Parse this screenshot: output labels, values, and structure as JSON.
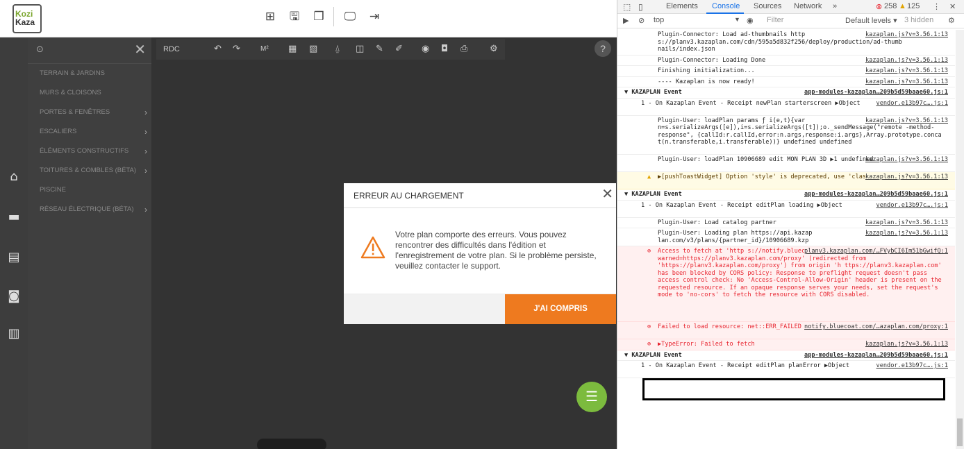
{
  "app": {
    "logo": {
      "line1": "Kozi",
      "line2": "Kaza"
    },
    "level": "RDC",
    "toolbar2": {
      "m2": "M²"
    },
    "sidebar": {
      "items": [
        {
          "label": "TERRAIN & JARDINS",
          "has_chevron": false
        },
        {
          "label": "MURS & CLOISONS",
          "has_chevron": false
        },
        {
          "label": "PORTES & FENÊTRES",
          "has_chevron": true
        },
        {
          "label": "ESCALIERS",
          "has_chevron": true
        },
        {
          "label": "ÉLÉMENTS CONSTRUCTIFS",
          "has_chevron": true
        },
        {
          "label": "TOITURES & COMBLES (BÉTA)",
          "has_chevron": true
        },
        {
          "label": "PISCINE",
          "has_chevron": false
        },
        {
          "label": "RÉSEAU ÉLECTRIQUE (BÉTA)",
          "has_chevron": true
        }
      ]
    },
    "modal": {
      "title": "ERREUR AU CHARGEMENT",
      "message": "Votre plan comporte des erreurs. Vous pouvez rencontrer des difficultés dans l'édition et l'enregistrement de votre plan. Si le problème persiste, veuillez contacter le support.",
      "button": "J'AI COMPRIS"
    },
    "colors": {
      "accent": "#ee7a1f",
      "chat": "#7cbb3e"
    }
  },
  "devtools": {
    "tabs": [
      "Elements",
      "Console",
      "Sources",
      "Network",
      "»"
    ],
    "active_tab": "Console",
    "errors": "258",
    "warnings": "125",
    "context": "top",
    "filter_placeholder": "Filter",
    "levels": "Default levels ▾",
    "hidden": "3 hidden",
    "rows": [
      {
        "type": "log",
        "text": "Plugin-Connector: Load ad-thumbnails http s://planv3.kazaplan.com/cdn/595a5d832f256/deploy/production/ad-thumb nails/index.json",
        "src": "kazaplan.js?v=3.56.1:13",
        "lines": 3
      },
      {
        "type": "log",
        "text": "Plugin-Connector: Loading Done",
        "src": "kazaplan.js?v=3.56.1:13",
        "lines": 1
      },
      {
        "type": "log",
        "text": "Finishing initialization...",
        "src": "kazaplan.js?v=3.56.1:13",
        "lines": 1
      },
      {
        "type": "log",
        "text": "---- Kazaplan is now ready!",
        "src": "kazaplan.js?v=3.56.1:13",
        "lines": 1
      },
      {
        "type": "group",
        "text": "▼ KAZAPLAN Event",
        "src": "app-modules-kazaplan…209b5d59baae60.js:1",
        "lines": 1
      },
      {
        "type": "l1",
        "text": "1 - On Kazaplan Event - Receipt newPlan starterscreen ▶Object",
        "src": "vendor.e13b97c….js:1",
        "lines": 2
      },
      {
        "type": "log",
        "text": "Plugin-User: loadPlan params ƒ i(e,t){var n=s.serializeArgs([e]),i=s.serializeArgs([t]);o._sendMessage(\"remote -method-response\", {callId:r.callId,error:n.args,response:i.args},Array.prototype.conca t(n.transferable,i.transferable))} undefined undefined",
        "src": "kazaplan.js?v=3.56.1:13",
        "lines": 5
      },
      {
        "type": "log",
        "text": "Plugin-User: loadPlan 10906689 edit MON PLAN 3D ▶1 undefined",
        "src": "kazaplan.js?v=3.56.1:13",
        "lines": 2
      },
      {
        "type": "warn",
        "text": "▶[pushToastWidget] Option 'style' is deprecated, use 'className' instead.",
        "src": "kazaplan.js?v=3.56.1:13",
        "lines": 2
      },
      {
        "type": "group",
        "text": "▼ KAZAPLAN Event",
        "src": "app-modules-kazaplan…209b5d59baae60.js:1",
        "lines": 1
      },
      {
        "type": "l1",
        "text": "1 - On Kazaplan Event - Receipt editPlan loading ▶Object",
        "src": "vendor.e13b97c….js:1",
        "lines": 2
      },
      {
        "type": "log",
        "text": "Plugin-User: Load catalog partner",
        "src": "kazaplan.js?v=3.56.1:13",
        "lines": 1
      },
      {
        "type": "log",
        "text": "Plugin-User: Loading plan https://api.kazap lan.com/v3/plans/{partner_id}/10906689.kzp",
        "src": "kazaplan.js?v=3.56.1:13",
        "lines": 2
      },
      {
        "type": "err",
        "text": "Access to fetch at 'http s://notify.bluecoat.com/?warned=https://planv3.kazaplan.com/proxy' (redirected from 'https://planv3.kazaplan.com/proxy') from origin 'h ttps://planv3.kazaplan.com' has been blocked by CORS policy: Response to preflight request doesn't pass access control check: No 'Access-Control-Allow-Origin' header is present on the requested resource. If an opaque response serves your needs, set the request's mode to 'no-cors' to fetch the resource with CORS disabled.",
        "src": "planv3.kazaplan.com/…FVybCI6Im51bGwifQ:1",
        "lines": 10
      },
      {
        "type": "err",
        "text": "Failed to load resource: net::ERR_FAILED",
        "src": "notify.bluecoat.com/…azaplan.com/proxy:1",
        "lines": 2
      },
      {
        "type": "err",
        "text": "▶TypeError: Failed to fetch",
        "src": "kazaplan.js?v=3.56.1:13",
        "lines": 1
      },
      {
        "type": "group",
        "text": "▼ KAZAPLAN Event",
        "src": "app-modules-kazaplan…209b5d59baae60.js:1",
        "lines": 1
      },
      {
        "type": "l1",
        "text": "1 - On Kazaplan Event - Receipt editPlan planError ▶Object",
        "src": "vendor.e13b97c….js:1",
        "lines": 2
      }
    ]
  }
}
